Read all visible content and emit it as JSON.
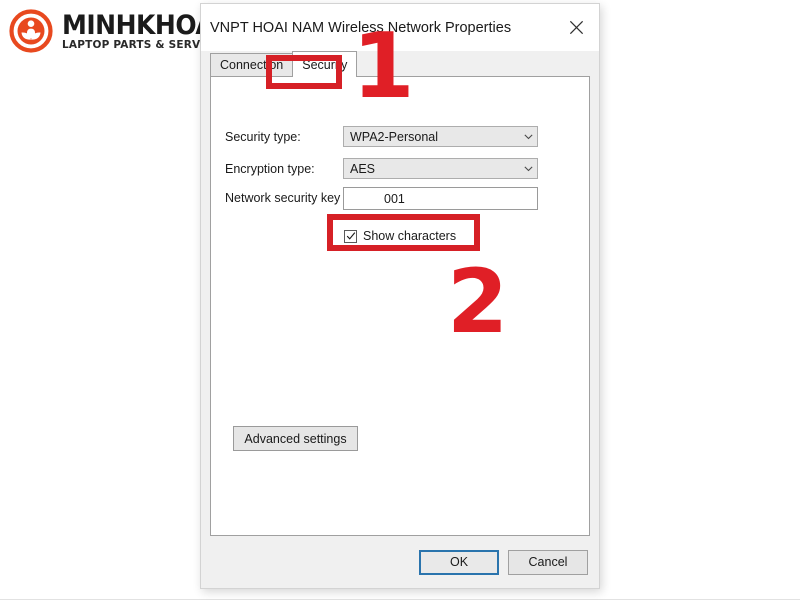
{
  "brand": {
    "name": "MINHKHOA",
    "tagline": "LAPTOP PARTS & SERVICES",
    "logo_icon": "minh-khoa-circle-logo",
    "accent_color": "#e8491f"
  },
  "dialog": {
    "title": "VNPT HOAI NAM Wireless Network Properties",
    "close_icon": "close-icon",
    "tabs": [
      {
        "label": "Connection",
        "active": false
      },
      {
        "label": "Security",
        "active": true
      }
    ],
    "fields": {
      "security_type": {
        "label": "Security type:",
        "value": "WPA2-Personal",
        "dropdown_icon": "chevron-down-icon"
      },
      "encryption_type": {
        "label": "Encryption type:",
        "value": "AES",
        "dropdown_icon": "chevron-down-icon"
      },
      "network_security_key": {
        "label": "Network security key",
        "value": "001",
        "placeholder": ""
      },
      "show_characters": {
        "label": "Show characters",
        "checked": true,
        "check_icon": "checkmark-icon"
      }
    },
    "advanced_button": "Advanced settings",
    "footer": {
      "ok": "OK",
      "cancel": "Cancel"
    }
  },
  "annotations": {
    "step_one": "1",
    "step_two": "2",
    "color": "#d62026"
  }
}
